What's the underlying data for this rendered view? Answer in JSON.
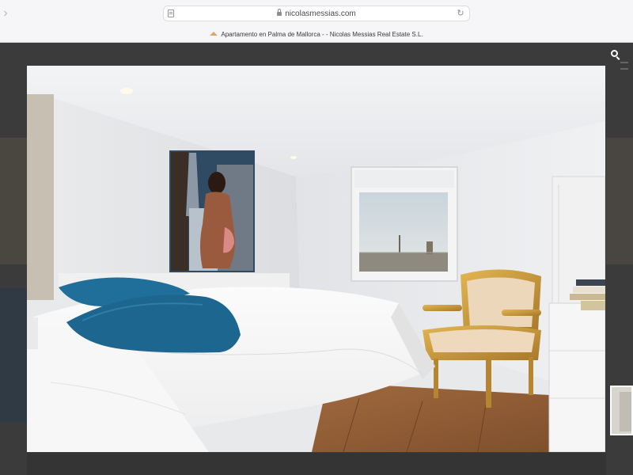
{
  "browser": {
    "url": "nicolasmessias.com",
    "tab_title": "Apartamento en Palma de Mallorca - - Nicolas Messias Real Estate S.L."
  },
  "lightbox": {
    "image_alt": "Bedroom with double bed, blue cushions, artwork, window with city view and gilded armchair"
  },
  "colors": {
    "chrome_bg": "#f6f5f7",
    "overlay": "#2d2d2d",
    "pillow_blue": "#1f6f9a",
    "chair_gold": "#c99a3c"
  }
}
